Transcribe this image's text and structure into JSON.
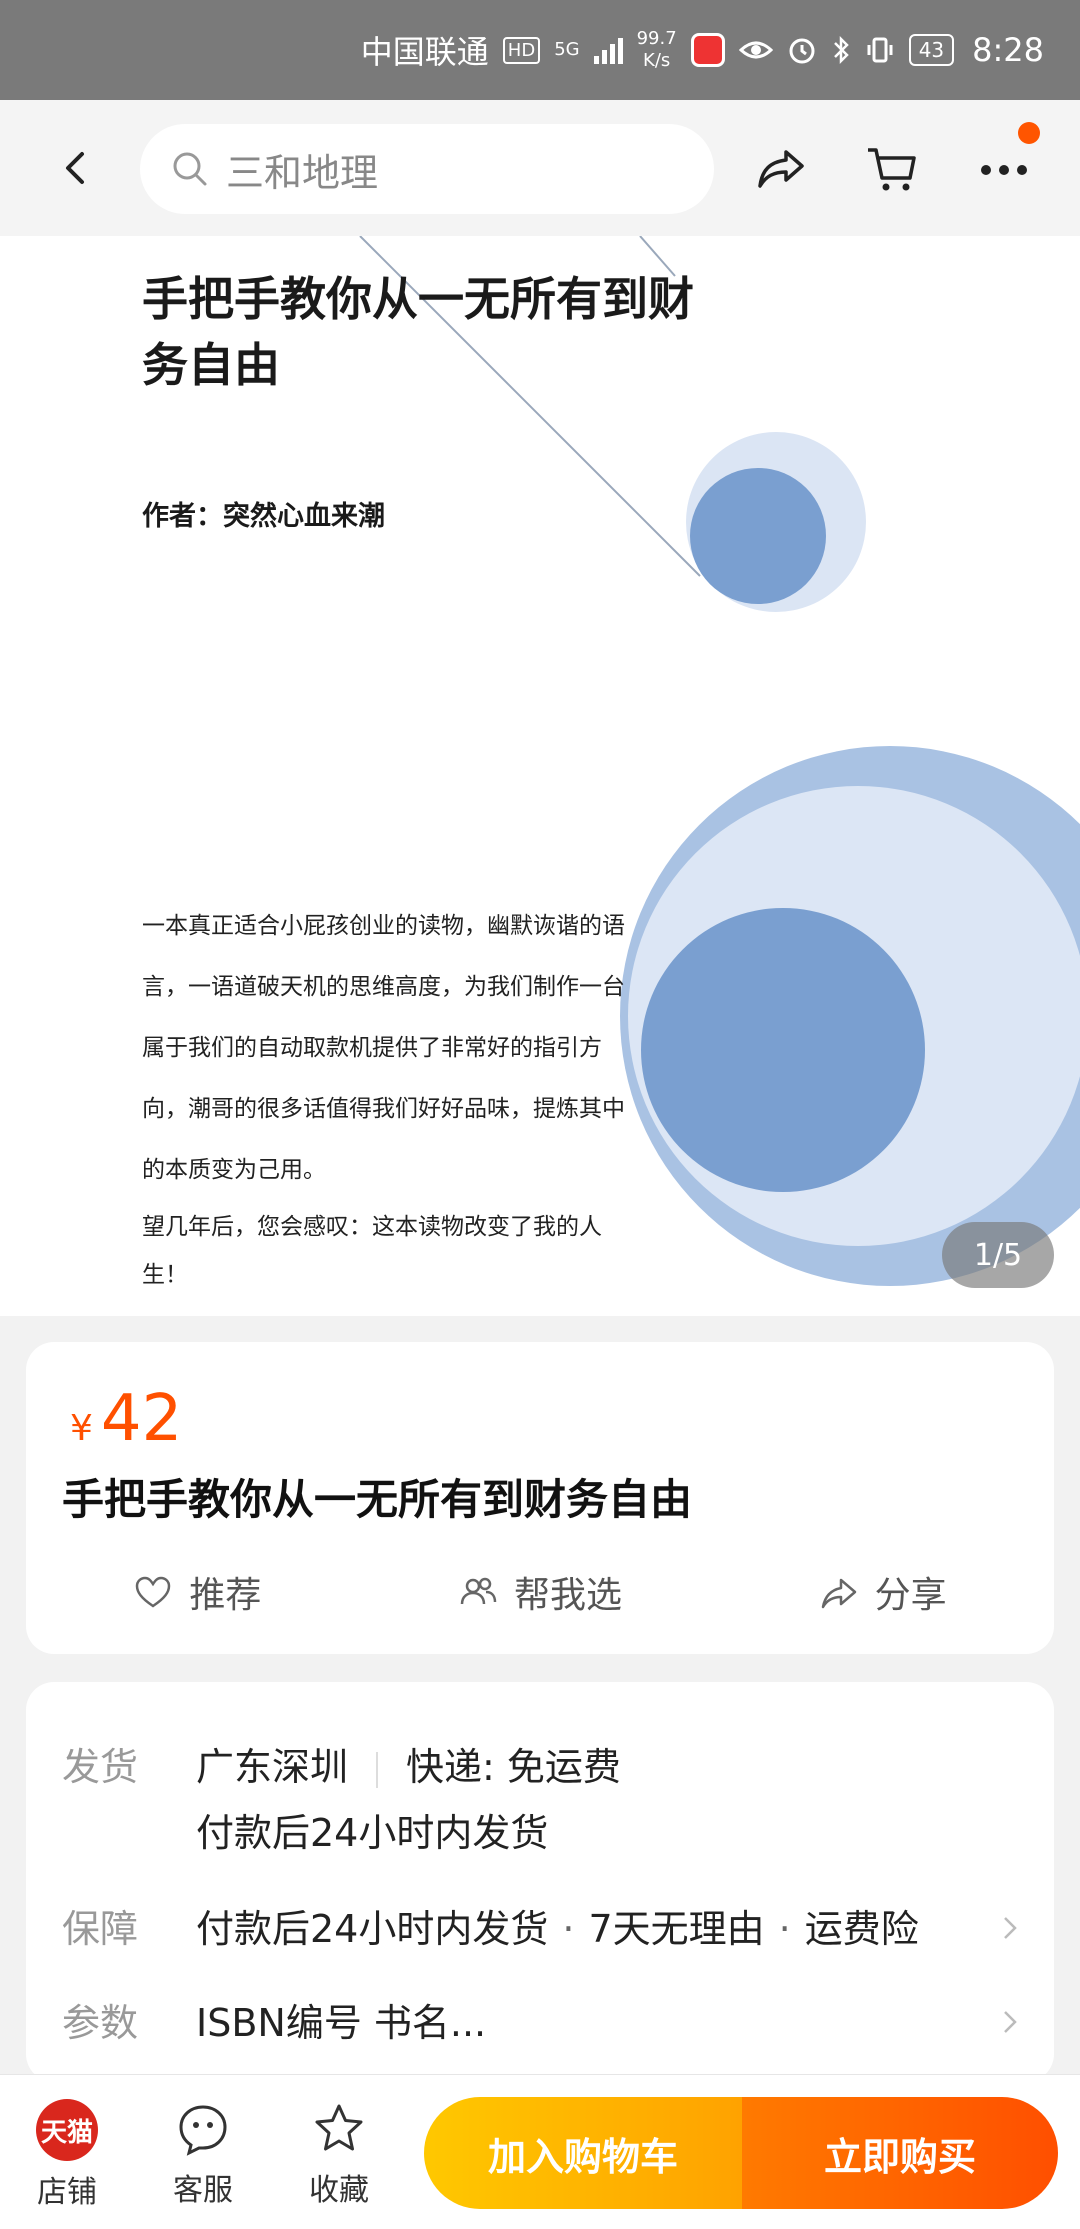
{
  "status_bar": {
    "carrier": "中国联通",
    "hd_badge": "HD",
    "network": "5G",
    "speed_value": "99.7",
    "speed_unit": "K/s",
    "battery": "43",
    "time": "8:28"
  },
  "nav": {
    "search_placeholder": "三和地理"
  },
  "gallery": {
    "cover_title": "手把手教你从一无所有到财务自由",
    "cover_author": "作者：突然心血来潮",
    "cover_blurb_1": "一本真正适合小屁孩创业的读物，幽默诙谐的语言，一语道破天机的思维高度，为我们制作一台属于我们的自动取款机提供了非常好的指引方向，潮哥的很多话值得我们好好品味，提炼其中的本质变为己用。",
    "cover_blurb_2": "望几年后，您会感叹：这本读物改变了我的人生！",
    "page_indicator": "1/5"
  },
  "product": {
    "currency": "¥",
    "price": "42",
    "title": "手把手教你从一无所有到财务自由",
    "actions": [
      "推荐",
      "帮我选",
      "分享"
    ]
  },
  "info": {
    "shipping_label": "发货",
    "shipping_location": "广东深圳",
    "shipping_method": "快递: 免运费",
    "shipping_time": "付款后24小时内发货",
    "guarantee_label": "保障",
    "guarantees": [
      "付款后24小时内发货",
      "7天无理由",
      "运费险"
    ],
    "params_label": "参数",
    "params_value": "ISBN编号 书名..."
  },
  "bottom_bar": {
    "store_logo_text": "天猫",
    "store": "店铺",
    "service": "客服",
    "favorite": "收藏",
    "add_to_cart": "加入购物车",
    "buy_now": "立即购买"
  },
  "colors": {
    "accent": "#ff5000",
    "cart_button": "#ffb300",
    "buy_button": "#ff5a00",
    "cover_blue": "#7a9fd0"
  }
}
